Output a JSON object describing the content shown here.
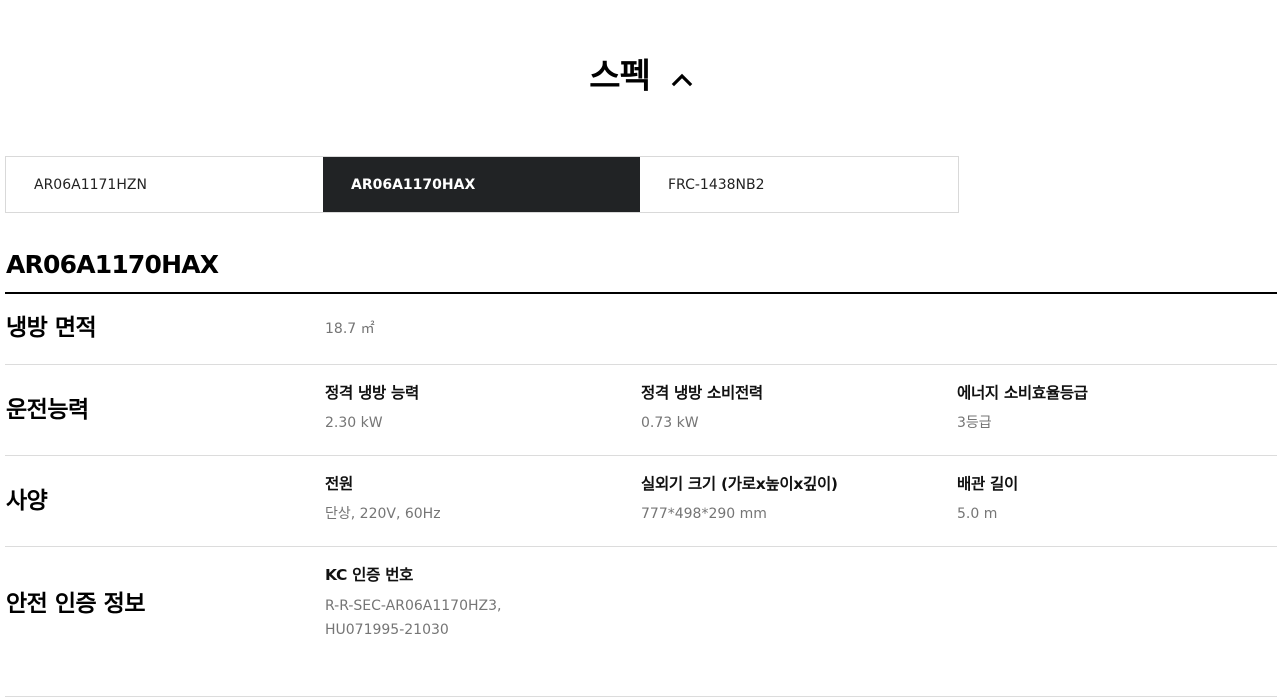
{
  "header": {
    "title": "스펙",
    "toggle_icon": "chevron-up-icon"
  },
  "tabs": [
    {
      "label": "AR06A1171HZN",
      "active": false
    },
    {
      "label": "AR06A1170HAX",
      "active": true
    },
    {
      "label": "FRC-1438NB2",
      "active": false
    }
  ],
  "model": {
    "name": "AR06A1170HAX"
  },
  "sections": [
    {
      "label": "냉방 면적",
      "items": [
        {
          "name": "",
          "value": "18.7 ㎡"
        }
      ]
    },
    {
      "label": "운전능력",
      "items": [
        {
          "name": "정격 냉방 능력",
          "value": "2.30 kW"
        },
        {
          "name": "정격 냉방 소비전력",
          "value": "0.73 kW"
        },
        {
          "name": "에너지 소비효율등급",
          "value": "3등급"
        }
      ]
    },
    {
      "label": "사양",
      "items": [
        {
          "name": "전원",
          "value": "단상, 220V, 60Hz"
        },
        {
          "name": "실외기 크기 (가로x높이x깊이)",
          "value": "777*498*290 mm"
        },
        {
          "name": "배관 길이",
          "value": "5.0 m"
        }
      ]
    },
    {
      "label": "안전 인증 정보",
      "items": [
        {
          "name": "KC 인증 번호",
          "value": "R-R-SEC-AR06A1170HZ3, HU071995-21030"
        }
      ]
    }
  ],
  "colors": {
    "active_tab_bg": "#212325",
    "divider": "#dcdcdc",
    "value_text": "#757575"
  }
}
